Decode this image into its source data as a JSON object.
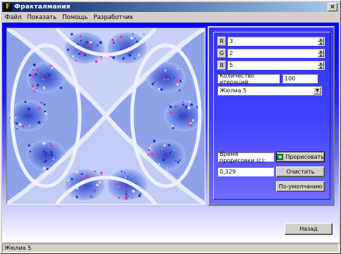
{
  "window": {
    "title": "Фракталмания",
    "icon_label": "F"
  },
  "menu": [
    "Файл",
    "Показать",
    "Помощь",
    "Разработчик"
  ],
  "rgb": [
    {
      "label": "R",
      "value": "3"
    },
    {
      "label": "G",
      "value": "2"
    },
    {
      "label": "B",
      "value": "5"
    }
  ],
  "iterations": {
    "label": "Количество итераций:",
    "value": "100"
  },
  "set": {
    "selected": "Жюлиа 5"
  },
  "render_time": {
    "label": "Время прорисовки (с):",
    "value": "0,329"
  },
  "buttons": {
    "draw": "Прорисовать",
    "clear": "Очистить",
    "save": "По-умолчанию",
    "back": "Назад"
  },
  "status": "Жюлиа 5",
  "colors": {
    "title_start": "#0a246a",
    "fractal_dark": "#1d3cc4",
    "fractal_mid": "#5a78e0",
    "fractal_light": "#d6ddf8",
    "fractal_accent": "#e23ca8"
  }
}
